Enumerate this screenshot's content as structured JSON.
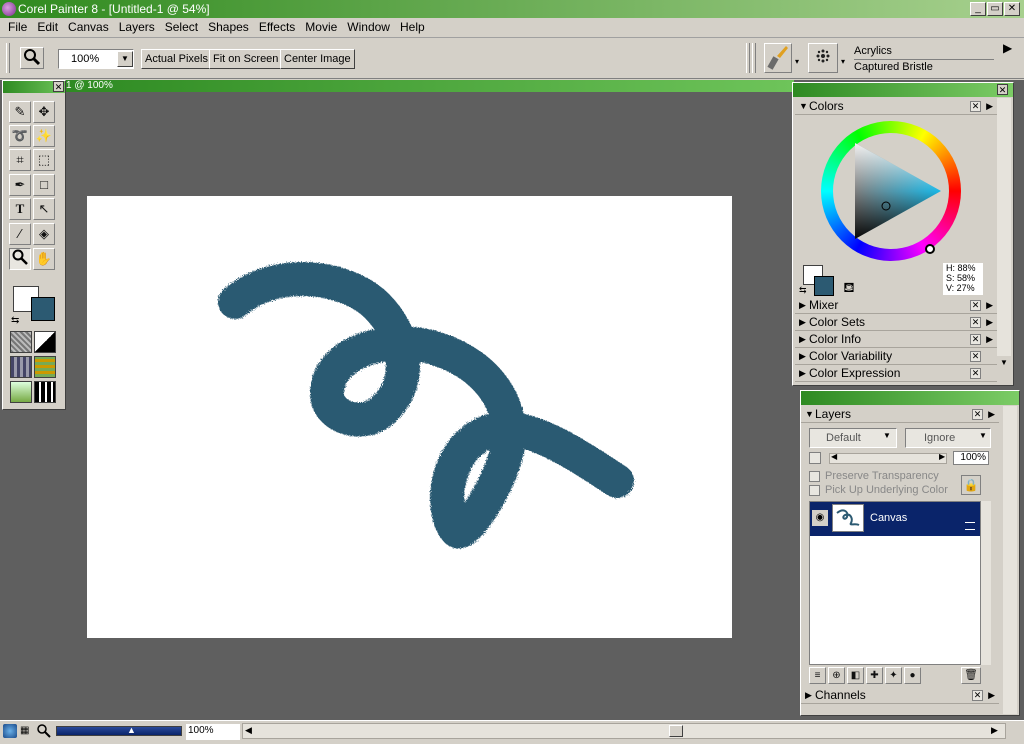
{
  "window": {
    "title": "Corel Painter 8 - [Untitled-1 @ 54%]",
    "min": "_",
    "restore": "▭",
    "close": "✕"
  },
  "menu": [
    "File",
    "Edit",
    "Canvas",
    "Layers",
    "Select",
    "Shapes",
    "Effects",
    "Movie",
    "Window",
    "Help"
  ],
  "toolbar": {
    "zoom_value": "100%",
    "actual_pixels": "Actual Pixels",
    "fit_on_screen": "Fit on Screen",
    "center_image": "Center Image",
    "brush_category": "Acrylics",
    "brush_variant": "Captured Bristle"
  },
  "document": {
    "tab_label": "1 @ 100%",
    "stroke_color": "#2c5a72"
  },
  "colors_panel": {
    "title": "Colors",
    "hsv_h": "H: 88%",
    "hsv_s": "S: 58%",
    "hsv_v": "V: 27%",
    "primary_color": "#ffffff",
    "secondary_color": "#2c5a72",
    "sections": [
      "Mixer",
      "Color Sets",
      "Color Info",
      "Color Variability",
      "Color Expression"
    ]
  },
  "layers_panel": {
    "title": "Layers",
    "composite_method": "Default",
    "composite_depth": "Ignore",
    "opacity": "100%",
    "preserve_transparency": "Preserve Transparency",
    "pick_up_underlying": "Pick Up Underlying Color",
    "layer_name": "Canvas",
    "channels": "Channels"
  },
  "status": {
    "zoom": "100%"
  },
  "icons": [
    "magnifier-icon",
    "brush-icon",
    "eye-icon",
    "lock-icon",
    "trash-icon"
  ]
}
